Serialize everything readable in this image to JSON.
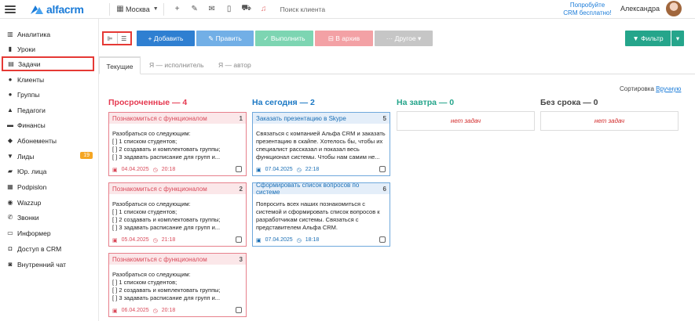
{
  "header": {
    "logo_text": "alfacrm",
    "city": "Москва",
    "search_placeholder": "Поиск клиента",
    "trial_line1": "Попробуйте",
    "trial_line2": "CRM бесплатно!",
    "user_name": "Александра"
  },
  "sidebar": {
    "items": [
      {
        "label": "Аналитика"
      },
      {
        "label": "Уроки"
      },
      {
        "label": "Задачи"
      },
      {
        "label": "Клиенты"
      },
      {
        "label": "Группы"
      },
      {
        "label": "Педагоги"
      },
      {
        "label": "Финансы"
      },
      {
        "label": "Абонементы"
      },
      {
        "label": "Лиды",
        "badge": "19"
      },
      {
        "label": "Юр. лица"
      },
      {
        "label": "Podpislon"
      },
      {
        "label": "Wazzup"
      },
      {
        "label": "Звонки"
      },
      {
        "label": "Информер"
      },
      {
        "label": "Доступ в CRM"
      },
      {
        "label": "Внутренний чат"
      }
    ]
  },
  "toolbar": {
    "add": "+ Добавить",
    "edit": "✎ Править",
    "done": "✓ Выполнить",
    "archive": "⊟ В архив",
    "other": "··· Другое ▾",
    "filter": "▼ Фильтр"
  },
  "tabs": [
    "Текущие",
    "Я — исполнитель",
    "Я — автор"
  ],
  "sort": {
    "label": "Сортировка",
    "value": "Вручную"
  },
  "columns": {
    "overdue": {
      "title": "Просроченные — 4",
      "cards": [
        {
          "title": "Познакомиться с функционалом",
          "num": "1",
          "lines": [
            "Разобраться со следующим:",
            "[ ] 1 списком студентов;",
            "[ ] 2 создавать и комплектовать группы;",
            "[ ] 3 задавать расписание для групп и..."
          ],
          "date": "04.04.2025",
          "time": "20:18"
        },
        {
          "title": "Познакомиться с функционалом",
          "num": "2",
          "lines": [
            "Разобраться со следующим:",
            "[ ] 1 списком студентов;",
            "[ ] 2 создавать и комплектовать группы;",
            "[ ] 3 задавать расписание для групп и..."
          ],
          "date": "05.04.2025",
          "time": "21:18"
        },
        {
          "title": "Познакомиться с функционалом",
          "num": "3",
          "lines": [
            "Разобраться со следующим:",
            "[ ] 1 списком студентов;",
            "[ ] 2 создавать и комплектовать группы;",
            "[ ] 3 задавать расписание для групп и..."
          ],
          "date": "06.04.2025",
          "time": "20:18"
        }
      ]
    },
    "today": {
      "title": "На сегодня — 2",
      "cards": [
        {
          "title": "Заказать презентацию в Skype",
          "num": "5",
          "lines": [
            "Связаться с компанией Альфа CRM и заказать",
            "презентацию в скайпе. Хотелось бы, чтобы их",
            "специалист рассказал и показал весь",
            "функционал системы. Чтобы нам самим не..."
          ],
          "date": "07.04.2025",
          "time": "22:18"
        },
        {
          "title": "Сформировать список вопросов по системе",
          "num": "6",
          "lines": [
            "Попросить всех наших познакомиться с",
            "системой и сформировать список вопросов к",
            "разработчикам системы. Связаться с",
            "представителем Альфа CRM."
          ],
          "date": "07.04.2025",
          "time": "18:18"
        }
      ]
    },
    "tomorrow": {
      "title": "На завтра — 0",
      "empty": "нет задач"
    },
    "no_deadline": {
      "title": "Без срока — 0",
      "empty": "нет задач"
    }
  }
}
